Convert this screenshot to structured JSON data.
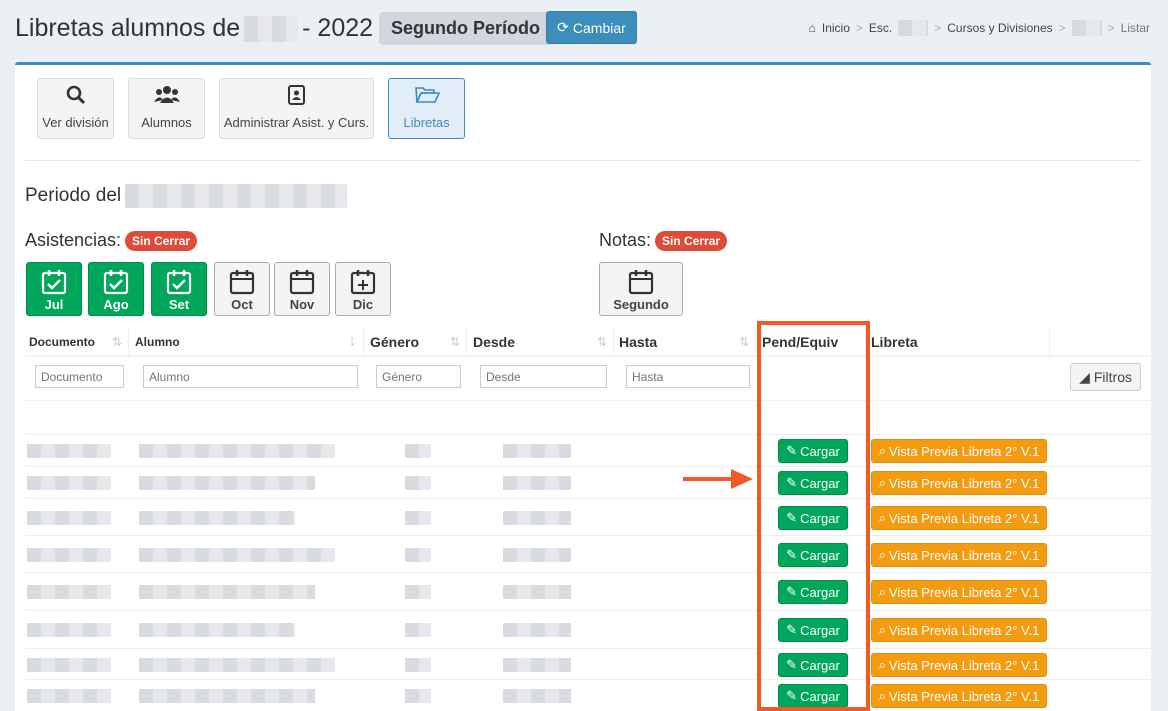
{
  "header": {
    "title_prefix": "Libretas alumnos de",
    "title_year": "- 2022",
    "period": "Segundo Período",
    "change_button": "Cambiar"
  },
  "breadcrumb": {
    "home": "Inicio",
    "school": "Esc.",
    "courses": "Cursos y Divisiones",
    "current": "Listar"
  },
  "toolbar": {
    "ver_division": "Ver división",
    "alumnos": "Alumnos",
    "administrar": "Administrar Asist. y Curs.",
    "libretas": "Libretas"
  },
  "periodo_label": "Periodo del",
  "asistencias": {
    "label": "Asistencias:",
    "badge": "Sin Cerrar",
    "months": [
      {
        "label": "Jul",
        "state": "closed"
      },
      {
        "label": "Ago",
        "state": "closed"
      },
      {
        "label": "Set",
        "state": "closed"
      },
      {
        "label": "Oct",
        "state": "open"
      },
      {
        "label": "Nov",
        "state": "open"
      },
      {
        "label": "Dic",
        "state": "add"
      }
    ]
  },
  "notas": {
    "label": "Notas:",
    "badge": "Sin Cerrar",
    "button": "Segundo"
  },
  "table": {
    "headers": {
      "documento": "Documento",
      "alumno": "Alumno",
      "genero": "Género",
      "desde": "Desde",
      "hasta": "Hasta",
      "pend": "Pend/Equiv",
      "libreta": "Libreta"
    },
    "placeholders": {
      "documento": "Documento",
      "alumno": "Alumno",
      "genero": "Género",
      "desde": "Desde",
      "hasta": "Hasta"
    },
    "filters_button": "Filtros",
    "row_action_cargar": "Cargar",
    "row_action_vista": "Vista Previa Libreta 2° V.1",
    "row_count": 9
  },
  "colors": {
    "primary": "#3c8dbc",
    "success": "#00a65a",
    "warning": "#f39c12",
    "danger": "#dd4b39",
    "annotation": "#f05a28"
  }
}
